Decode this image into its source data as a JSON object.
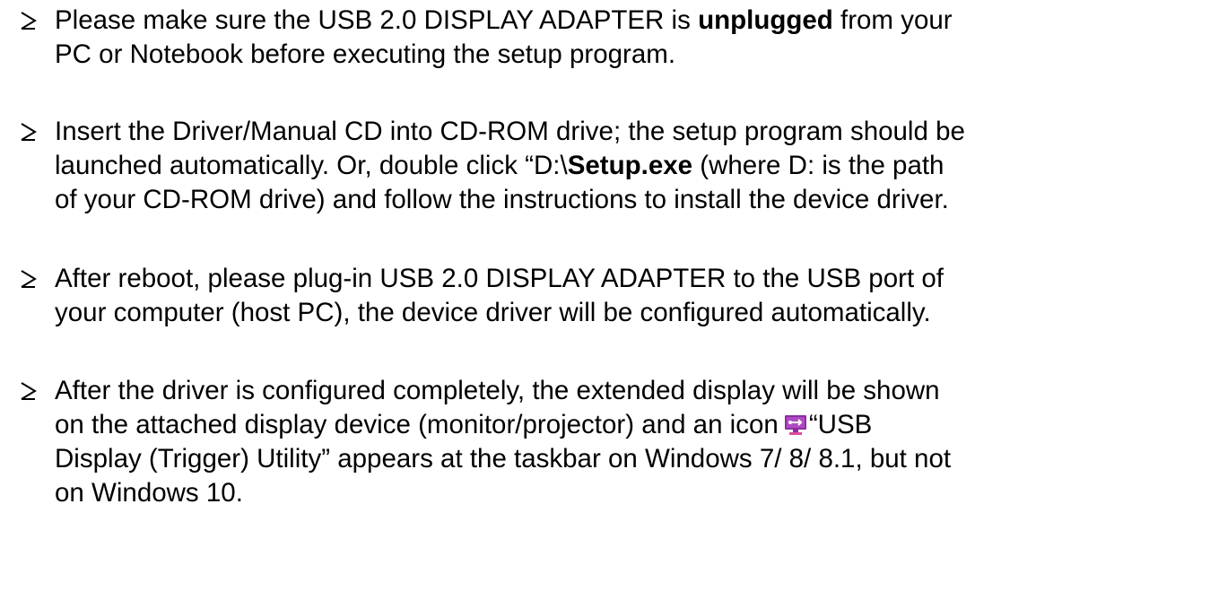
{
  "items": [
    {
      "l1_a": "Please make sure the USB 2.0 DISPLAY ADAPTER is ",
      "l1_bold": "unplugged",
      "l1_b": " from your",
      "l2": "PC or Notebook before executing the setup program."
    },
    {
      "l1": "Insert the Driver/Manual CD into CD-ROM drive; the setup program should be",
      "l2_a": "launched automatically. Or, double click “D:\\",
      "l2_bold": "Setup.exe",
      "l2_b": " (where D: is the path",
      "l3": "of your CD-ROM drive) and follow the instructions to install the device driver."
    },
    {
      "l1": "After reboot, please plug-in USB 2.0 DISPLAY ADAPTER to the USB port of",
      "l2": "your computer (host PC), the device driver will be configured automatically."
    },
    {
      "l1": "After the driver is configured completely, the extended display will be shown",
      "l2_a": "on the attached display device (monitor/projector) and an icon",
      "l2_b": "“USB",
      "l3": "Display (Trigger) Utility” appears at the taskbar on Windows 7/ 8/ 8.1, but not",
      "l4": "on Windows 10."
    }
  ],
  "icons": {
    "bullet": "arrowhead-bullet-icon",
    "utility": "usb-display-utility-icon"
  },
  "colors": {
    "text": "#000000",
    "background": "#ffffff",
    "icon_purple": "#8b2fa0",
    "icon_pink": "#e04a9a"
  }
}
